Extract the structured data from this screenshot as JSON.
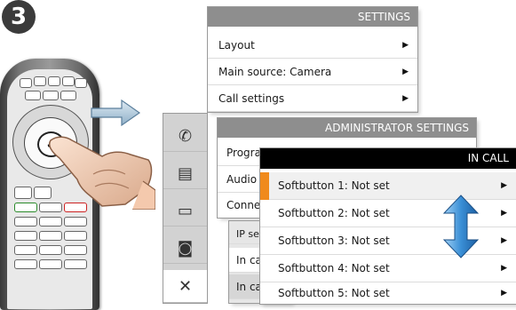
{
  "step": {
    "number": "3"
  },
  "settings": {
    "title": "SETTINGS",
    "items": [
      {
        "label": "Layout"
      },
      {
        "label": "Main source: Camera"
      },
      {
        "label": "Call settings"
      }
    ]
  },
  "admin": {
    "title": "ADMINISTRATOR SETTINGS",
    "items": [
      {
        "label": "Programmable softbuttons"
      },
      {
        "label": "Audio"
      },
      {
        "label": "Connection"
      },
      {
        "label": "IP settings"
      }
    ]
  },
  "partial": {
    "items": [
      {
        "label": "In call"
      },
      {
        "label": "In call"
      }
    ]
  },
  "incall": {
    "title": "IN CALL",
    "items": [
      {
        "label": "Softbutton 1: Not set"
      },
      {
        "label": "Softbutton 2: Not set"
      },
      {
        "label": "Softbutton 3: Not set"
      },
      {
        "label": "Softbutton 4: Not set"
      },
      {
        "label": "Softbutton 5: Not set"
      }
    ]
  },
  "colors": {
    "accent": "#f08a1c",
    "title_bar": "#8e8e8e",
    "arrow_blue": "#3a8fd6"
  },
  "icons": [
    "phone-icon",
    "calendar-icon",
    "laptop-icon",
    "camera-icon",
    "tools-icon"
  ]
}
